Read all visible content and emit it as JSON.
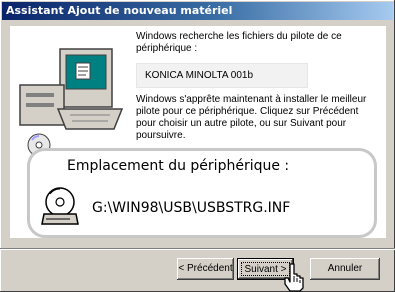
{
  "window": {
    "title": "Assistant Ajout de nouveau matériel"
  },
  "content": {
    "search_text": "Windows recherche les fichiers du pilote de ce périphérique :",
    "device_name": "KONICA MINOLTA 001b",
    "install_text": "Windows s'apprête maintenant à installer le meilleur pilote pour ce périphérique. Cliquez sur Précédent pour choisir un autre pilote, ou sur Suivant pour poursuivre.",
    "location_label": "Emplacement du périphérique :",
    "location_path": "G:\\WIN98\\USB\\USBSTRG.INF"
  },
  "buttons": {
    "prev_label": "< Précédent",
    "next_label": "Suivant >",
    "cancel_label": "Annuler"
  }
}
